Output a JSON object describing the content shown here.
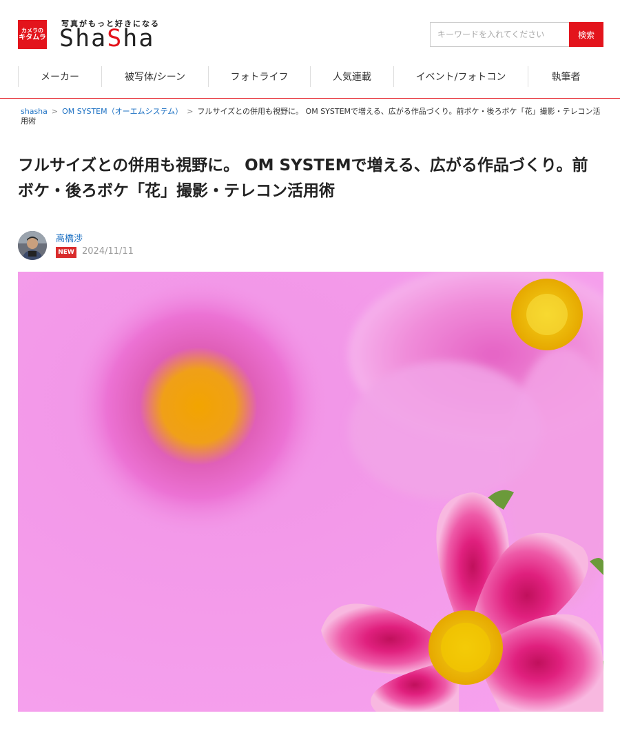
{
  "brand": {
    "logo_line1": "カメラの",
    "logo_line2": "キタムラ",
    "tagline": "写真がもっと好きになる",
    "name_part1": "Sha",
    "name_part2": "S",
    "name_part3": "ha",
    "accent_color": "#e3141c"
  },
  "search": {
    "placeholder": "キーワードを入れてください",
    "button_label": "検索"
  },
  "nav": {
    "items": [
      "メーカー",
      "被写体/シーン",
      "フォトライフ",
      "人気連載",
      "イベント/フォトコン",
      "執筆者"
    ]
  },
  "breadcrumb": {
    "home": "shasha",
    "category": "OM SYSTEM（オーエムシステム）",
    "current": "フルサイズとの併用も視野に。 OM SYSTEMで増える、広がる作品づくり。前ボケ・後ろボケ「花」撮影・テレコン活用術",
    "separator": ">"
  },
  "article": {
    "title": "フルサイズとの併用も視野に。 OM SYSTEMで増える、広がる作品づくり。前ボケ・後ろボケ「花」撮影・テレコン活用術",
    "author": "高橋渉",
    "badge": "NEW",
    "date": "2024/11/11"
  },
  "icons": {
    "avatar": "author-photo",
    "hero": "cosmos-flower-photo"
  }
}
